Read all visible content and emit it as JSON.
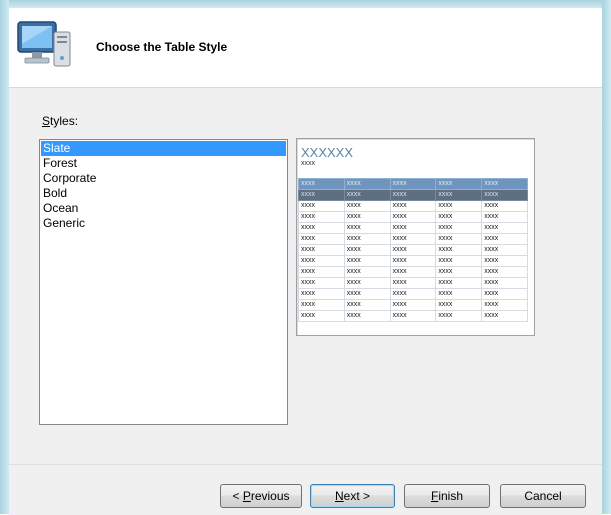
{
  "wizard": {
    "page_title": "Choose the Table Style",
    "styles_label": "Styles:",
    "styles": [
      {
        "label": "Slate",
        "selected": true
      },
      {
        "label": "Forest",
        "selected": false
      },
      {
        "label": "Corporate",
        "selected": false
      },
      {
        "label": "Bold",
        "selected": false
      },
      {
        "label": "Ocean",
        "selected": false
      },
      {
        "label": "Generic",
        "selected": false
      }
    ]
  },
  "preview": {
    "title": "XXXXXX",
    "subtitle": "xxxx",
    "header_cells": [
      "xxxx",
      "xxxx",
      "xxxx",
      "xxxx",
      "xxxx"
    ],
    "row_cells": [
      "xxxx",
      "xxxx",
      "xxxx",
      "xxxx",
      "xxxx"
    ],
    "data_row_count": 12
  },
  "buttons": {
    "previous": {
      "prefix": "< ",
      "mnemonic": "P",
      "rest": "revious"
    },
    "next": {
      "mnemonic": "N",
      "rest": "ext >"
    },
    "finish": {
      "mnemonic": "F",
      "rest": "inish"
    },
    "cancel": {
      "label": "Cancel"
    }
  },
  "colors": {
    "selection": "#3399ff",
    "preview_header": "#6f95be",
    "preview_selected_row": "#5f6f82",
    "preview_title": "#5b84a5"
  }
}
